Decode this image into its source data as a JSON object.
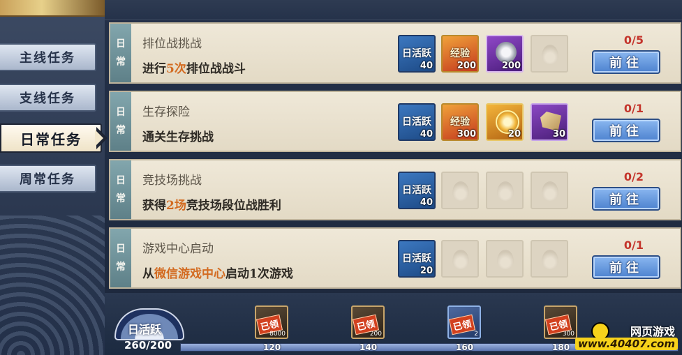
{
  "nav": {
    "tabs": [
      {
        "label": "主线任务",
        "active": false
      },
      {
        "label": "支线任务",
        "active": false
      },
      {
        "label": "日常任务",
        "active": true
      },
      {
        "label": "周常任务",
        "active": false
      }
    ]
  },
  "quests": [
    {
      "type_chars": [
        "日",
        "常"
      ],
      "title": "排位战挑战",
      "desc_parts": [
        "进行",
        "5次",
        "排位战战斗"
      ],
      "rewards": [
        {
          "icon": "activity-icon",
          "label": "日活跃",
          "qty": "40"
        },
        {
          "icon": "exp-icon",
          "label": "经验",
          "qty": "200"
        },
        {
          "icon": "silver-coin-icon",
          "label": "",
          "qty": "200"
        },
        {
          "icon": "empty-slot-icon",
          "label": "",
          "qty": ""
        }
      ],
      "progress": "0/5",
      "button": "前往"
    },
    {
      "type_chars": [
        "日",
        "常"
      ],
      "title": "生存探险",
      "desc_parts": [
        "通关生存挑战",
        "",
        ""
      ],
      "rewards": [
        {
          "icon": "activity-icon",
          "label": "日活跃",
          "qty": "40"
        },
        {
          "icon": "exp-icon",
          "label": "经验",
          "qty": "300"
        },
        {
          "icon": "gold-coin-icon",
          "label": "",
          "qty": "20"
        },
        {
          "icon": "ore-icon",
          "label": "",
          "qty": "30"
        }
      ],
      "progress": "0/1",
      "button": "前往"
    },
    {
      "type_chars": [
        "日",
        "常"
      ],
      "title": "竞技场挑战",
      "desc_parts": [
        "获得",
        "2场",
        "竞技场段位战胜利"
      ],
      "rewards": [
        {
          "icon": "activity-icon",
          "label": "日活跃",
          "qty": "40"
        },
        {
          "icon": "empty-slot-icon",
          "label": "",
          "qty": ""
        },
        {
          "icon": "empty-slot-icon",
          "label": "",
          "qty": ""
        },
        {
          "icon": "empty-slot-icon",
          "label": "",
          "qty": ""
        }
      ],
      "progress": "0/2",
      "button": "前往"
    },
    {
      "type_chars": [
        "日",
        "常"
      ],
      "title": "游戏中心启动",
      "desc_parts": [
        "从",
        "微信游戏中心",
        "启动1次游戏"
      ],
      "rewards": [
        {
          "icon": "activity-icon",
          "label": "日活跃",
          "qty": "20"
        },
        {
          "icon": "empty-slot-icon",
          "label": "",
          "qty": ""
        },
        {
          "icon": "empty-slot-icon",
          "label": "",
          "qty": ""
        },
        {
          "icon": "empty-slot-icon",
          "label": "",
          "qty": ""
        }
      ],
      "progress": "0/1",
      "button": "前往"
    }
  ],
  "activity": {
    "label": "日活跃",
    "score": "260/200",
    "progress_fraction": 1.0,
    "milestones": [
      {
        "value": "120",
        "stamp": "已领",
        "amount": "8000",
        "style": "dark"
      },
      {
        "value": "140",
        "stamp": "已领",
        "amount": "200",
        "style": "dark"
      },
      {
        "value": "160",
        "stamp": "已领",
        "amount": "2",
        "style": "blue"
      },
      {
        "value": "180",
        "stamp": "已领",
        "amount": "300",
        "style": "dark"
      }
    ]
  },
  "watermark": {
    "top": "网页游戏",
    "bottom": "www.40407.com"
  }
}
